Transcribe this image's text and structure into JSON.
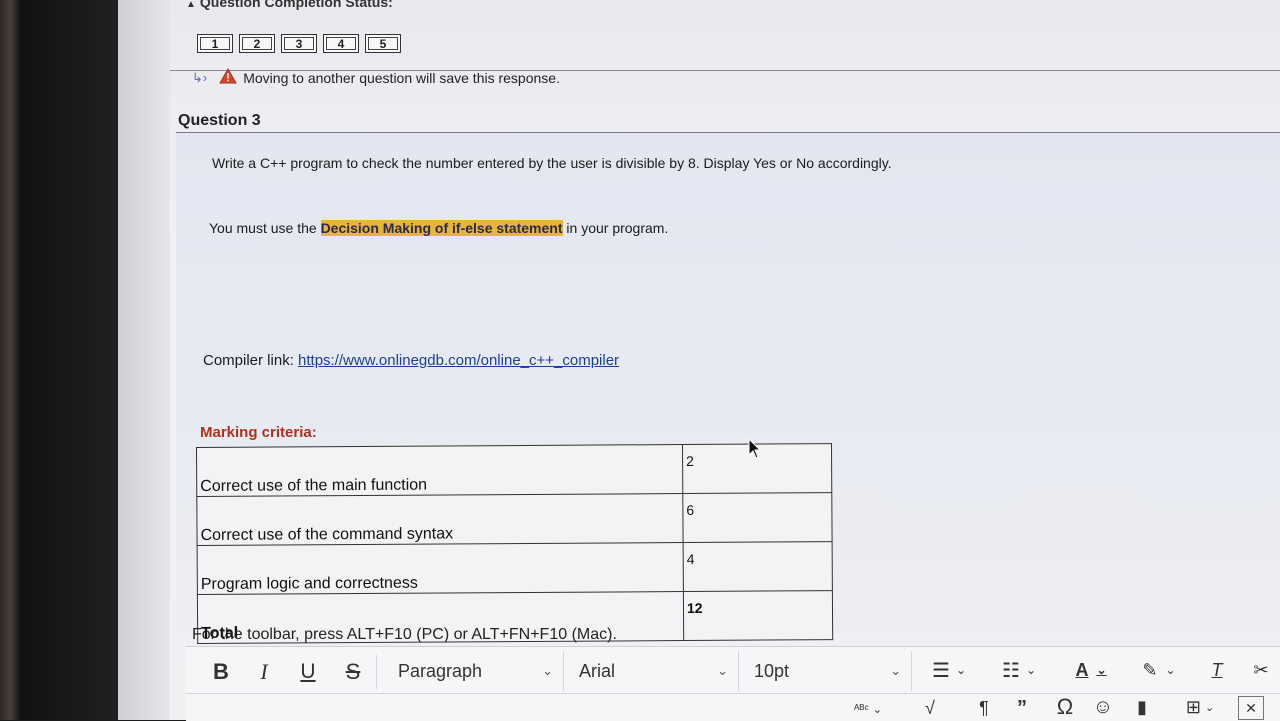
{
  "status": {
    "title": "Question Completion Status:",
    "questions": [
      "1",
      "2",
      "3",
      "4",
      "5"
    ]
  },
  "save_note": "Moving to another question will save this response.",
  "question": {
    "title": "Question 3",
    "prompt": "Write a C++ program to check the number entered by the user is divisible by 8. Display Yes or No accordingly.",
    "requirement_pre": "You must use the ",
    "requirement_highlight": "Decision Making of if-else statement",
    "requirement_post": " in your program.",
    "compiler_label": "Compiler link: ",
    "compiler_url": "https://www.onlinegdb.com/online_c++_compiler",
    "marking_label": "Marking criteria:",
    "criteria": [
      {
        "item": "Correct use of the main function",
        "score": "2"
      },
      {
        "item": "Correct use of the command syntax",
        "score": "6"
      },
      {
        "item": "Program logic and correctness",
        "score": "4"
      },
      {
        "item": "Total",
        "score": "12"
      }
    ]
  },
  "editor": {
    "toolbar_hint": "For the toolbar, press ALT+F10 (PC) or ALT+FN+F10 (Mac).",
    "paragraph": "Paragraph",
    "font": "Arial",
    "size": "10pt",
    "bold": "B",
    "italic": "I",
    "underline": "U",
    "strike": "S"
  },
  "colors": {
    "highlight": "#e9b43a",
    "marking_red": "#b0301e",
    "link_blue": "#1a3f9a"
  },
  "icons": [
    "arrow-return-icon",
    "warning-icon",
    "bullet-list-icon",
    "numbered-list-icon",
    "text-color-icon",
    "highlight-pen-icon",
    "clear-format-icon",
    "cut-icon",
    "spellcheck-icon",
    "math-icon",
    "pilcrow-icon",
    "quote-icon",
    "omega-icon",
    "emoji-icon",
    "bookmark-icon",
    "table-icon",
    "close-box-icon",
    "mouse-cursor-icon"
  ]
}
